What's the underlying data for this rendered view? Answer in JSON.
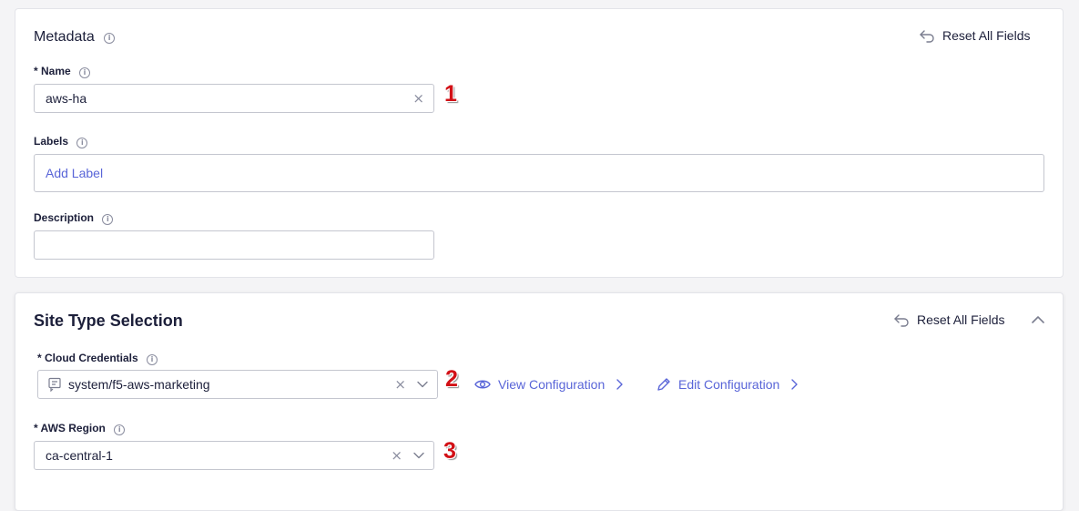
{
  "metadata": {
    "title": "Metadata",
    "reset_label": "Reset All Fields",
    "name": {
      "label": "* Name",
      "value": "aws-ha"
    },
    "labels": {
      "label": "Labels",
      "placeholder": "Add Label"
    },
    "description": {
      "label": "Description",
      "value": ""
    }
  },
  "site_type": {
    "title": "Site Type Selection",
    "reset_label": "Reset All Fields",
    "cloud_credentials": {
      "label": "* Cloud Credentials",
      "value": "system/f5-aws-marketing",
      "view_label": "View Configuration",
      "edit_label": "Edit Configuration"
    },
    "aws_region": {
      "label": "* AWS Region",
      "value": "ca-central-1"
    }
  },
  "annotations": [
    "1",
    "2",
    "3"
  ],
  "colors": {
    "accent": "#5965d8",
    "annotation": "#d21016",
    "text": "#1c1f3a"
  }
}
